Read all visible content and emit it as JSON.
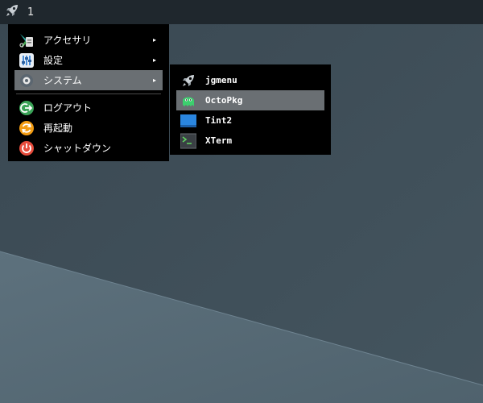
{
  "taskbar": {
    "launcher_icon": "rocket-icon",
    "desktop_number": "1"
  },
  "main_menu": {
    "items": [
      {
        "label": "アクセサリ",
        "icon": "accessories-icon",
        "has_submenu": true
      },
      {
        "label": "設定",
        "icon": "settings-icon",
        "has_submenu": true
      },
      {
        "label": "システム",
        "icon": "system-icon",
        "has_submenu": true,
        "selected": true
      },
      {
        "label": "ログアウト",
        "icon": "logout-icon",
        "has_submenu": false
      },
      {
        "label": "再起動",
        "icon": "reboot-icon",
        "has_submenu": false
      },
      {
        "label": "シャットダウン",
        "icon": "shutdown-icon",
        "has_submenu": false
      }
    ],
    "submenu_arrow": "▸"
  },
  "system_submenu": {
    "items": [
      {
        "label": "jgmenu",
        "icon": "rocket-icon"
      },
      {
        "label": "OctoPkg",
        "icon": "octopkg-icon",
        "selected": true
      },
      {
        "label": "Tint2",
        "icon": "tint2-icon"
      },
      {
        "label": "XTerm",
        "icon": "terminal-icon"
      }
    ]
  },
  "colors": {
    "desktop_top": "#3b4a55",
    "desktop_bottom": "#5b6f7b",
    "taskbar": "#1f272d",
    "menu_bg": "#000000",
    "selection": "#6a6f73"
  }
}
